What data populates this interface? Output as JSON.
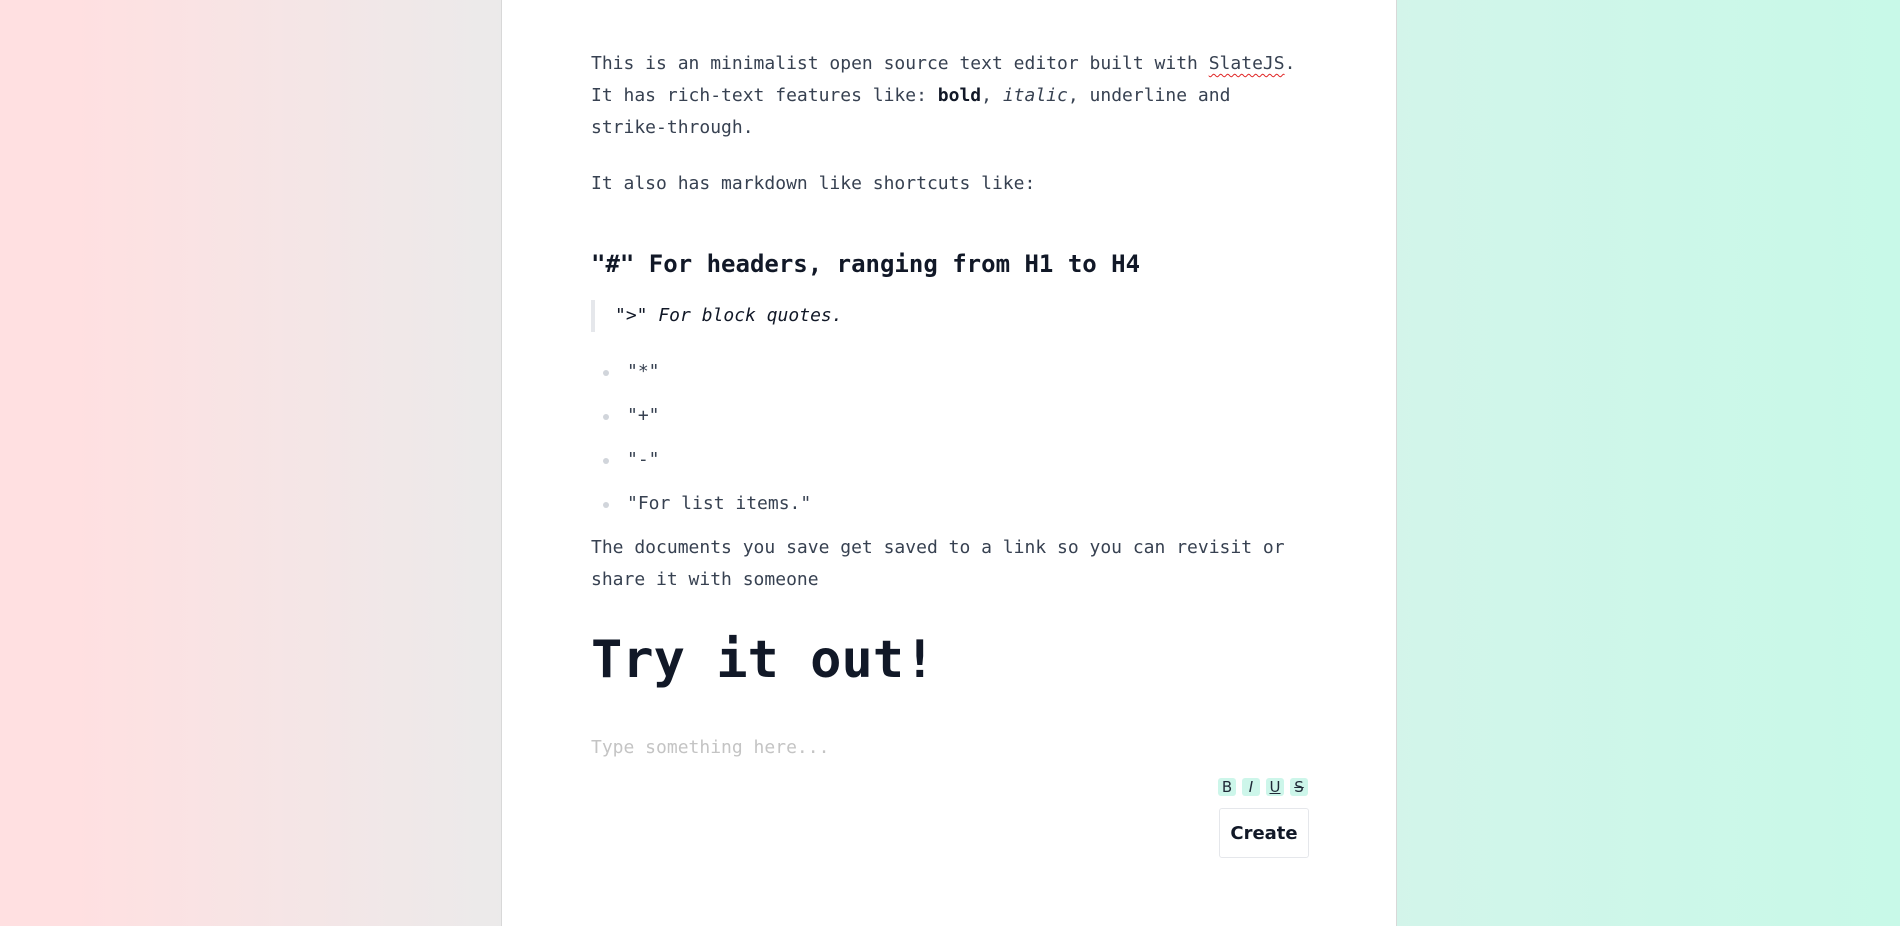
{
  "editor": {
    "intro": {
      "line1_prefix": "This is an minimalist open source text editor built with ",
      "slatejs": "SlateJS",
      "line1_suffix": ".",
      "line2_prefix": "It has rich-text features like: ",
      "bold": "bold",
      "comma": ", ",
      "italic": "italic",
      "line2_suffix": ", underline and strike-through."
    },
    "markdown_intro": "It also has markdown like shortcuts like:",
    "heading_example": "\"#\" For headers, ranging from H1 to H4",
    "blockquote_example": "\">\" For block quotes.",
    "list_items": [
      "\"*\"",
      "\"+\"",
      "\"-\"",
      "\"For list items.\""
    ],
    "save_note": "The documents you save get saved to a link so you can revisit or share it with someone",
    "try_heading": "Try it out!",
    "placeholder": "Type something here..."
  },
  "toolbar": {
    "bold_label": "B",
    "italic_label": "I",
    "underline_label": "U",
    "strike_label": "S",
    "create_label": "Create"
  },
  "colors": {
    "accent": "#cdf6ea",
    "spell_error": "#e02424"
  }
}
